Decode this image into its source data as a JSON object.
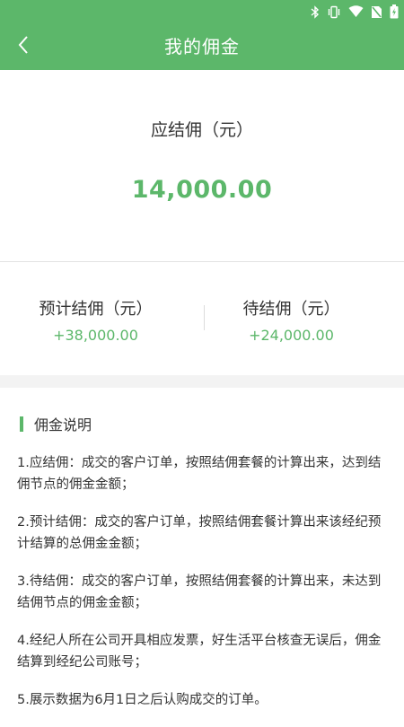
{
  "header": {
    "title": "我的佣金",
    "colors": {
      "primary": "#5cb76a"
    },
    "status_icons": [
      "bluetooth-icon",
      "vibrate-icon",
      "wifi-icon",
      "no-sim-icon",
      "battery-charging-icon"
    ],
    "back_icon": "chevron-left-icon"
  },
  "summary": {
    "label": "应结佣（元）",
    "amount": "14,000.00"
  },
  "stats": {
    "estimated_label": "预计结佣（元）",
    "estimated_value": "+38,000.00",
    "pending_label": "待结佣（元）",
    "pending_value": "+24,000.00"
  },
  "explain": {
    "title": "佣金说明",
    "items": [
      "1.应结佣：成交的客户订单，按照结佣套餐的计算出来，达到结佣节点的佣金金额；",
      "2.预计结佣：成交的客户订单，按照结佣套餐计算出来该经纪预计结算的总佣金金额；",
      "3.待结佣：成交的客户订单，按照结佣套餐的计算出来，未达到结佣节点的佣金金额；",
      "4.经纪人所在公司开具相应发票，好生活平台核查无误后，佣金结算到经纪公司账号；",
      "5.展示数据为6月1日之后认购成交的订单。"
    ]
  }
}
